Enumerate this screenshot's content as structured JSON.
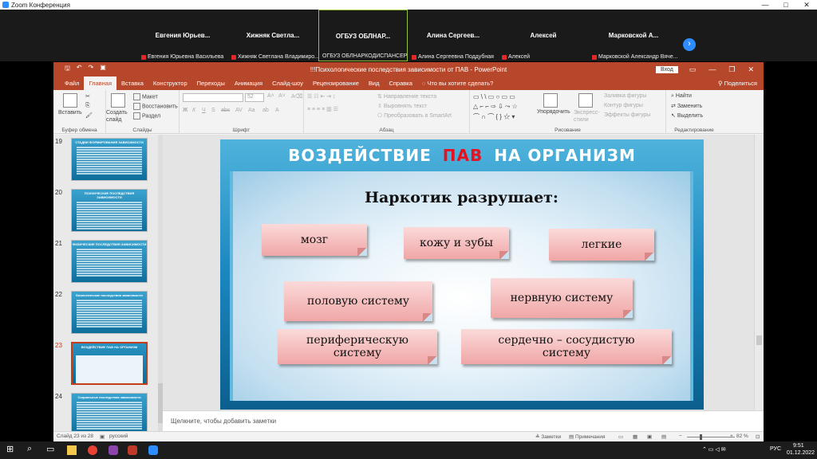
{
  "zoom": {
    "window_title": "Zoom Конференция",
    "window_controls": [
      "—",
      "□",
      "✕"
    ],
    "participants": [
      {
        "name": "Евгения Юрьев...",
        "full_name": "Евгения Юрьевна Васильева"
      },
      {
        "name": "Хижняк Светла...",
        "full_name": "Хижняк Светлана Владимиро..."
      },
      {
        "name": "ОГБУЗ ОБЛНАР...",
        "full_name": "ОГБУЗ ОБЛНАРКОДИСПАНСЕР"
      },
      {
        "name": "Алина Сергеев...",
        "full_name": "Алина Сергеевна Поддубная"
      },
      {
        "name": "Алексей",
        "full_name": "Алексей"
      },
      {
        "name": "Марковской А...",
        "full_name": "Марковской Александр Вяче..."
      }
    ],
    "next_arrow": "›"
  },
  "ppt": {
    "doc_title": "!!!Психологические последствия зависимости от ПАВ - PowerPoint",
    "login_label": "Вход",
    "tabs": [
      "Файл",
      "Главная",
      "Вставка",
      "Конструктор",
      "Переходы",
      "Анимация",
      "Слайд-шоу",
      "Рецензирование",
      "Вид",
      "Справка"
    ],
    "active_tab": "Главная",
    "tell_me": "Что вы хотите сделать?",
    "share_label": "Поделиться",
    "ribbon": {
      "paste": "Вставить",
      "clipboard_group": "Буфер обмена",
      "new_slide": "Создать слайд",
      "layout": "Макет",
      "reset": "Восстановить",
      "section": "Раздел",
      "slides_group": "Слайды",
      "font_size": "52",
      "font_group": "Шрифт",
      "text_direction": "Направление текста",
      "align_text": "Выровнять текст",
      "smartart": "Преобразовать в SmartArt",
      "paragraph_group": "Абзац",
      "arrange": "Упорядочить",
      "quick_styles": "Экспресс-стили",
      "shape_fill": "Заливка фигуры",
      "shape_outline": "Контур фигуры",
      "shape_effects": "Эффекты фигуры",
      "drawing_group": "Рисование",
      "find": "Найти",
      "replace": "Заменить",
      "select": "Выделить",
      "editing_group": "Редактирование"
    },
    "thumbnails": [
      {
        "num": "19",
        "title": "СТАДИИ ФОРМИРОВАНИЯ ЗАВИСИМОСТИ"
      },
      {
        "num": "20",
        "title": "ПСИХИЧЕСКИЕ ПОСЛЕДСТВИЯ ЗАВИСИМОСТИ"
      },
      {
        "num": "21",
        "title": "ФИЗИЧЕСКИЕ ПОСЛЕДСТВИЯ ЗАВИСИМОСТИ"
      },
      {
        "num": "22",
        "title": "Биологические последствия зависимости"
      },
      {
        "num": "23",
        "title": "ВОЗДЕЙСТВИЕ ПАВ НА ОРГАНИЗМ"
      },
      {
        "num": "24",
        "title": "Социальные последствия зависимости"
      }
    ],
    "notes_placeholder": "Щелкните, чтобы добавить заметки",
    "status": {
      "slide_counter": "Слайд 23 из 28",
      "language": "русский",
      "notes": "Заметки",
      "comments": "Примечания",
      "zoom": "82 %"
    }
  },
  "slide": {
    "title_left": "ВОЗДЕЙСТВИЕ",
    "title_highlight": "ПАВ",
    "title_right": "НА ОРГАНИЗМ",
    "subtitle": "Наркотик разрушает:",
    "cards": [
      "мозг",
      "кожу и зубы",
      "легкие",
      "половую систему",
      "нервную систему",
      "периферическую систему",
      "сердечно – сосудистую систему"
    ],
    "colors": {
      "highlight": "#e8121e",
      "card": "#f5b9b9",
      "ppt_accent": "#b7472a"
    }
  },
  "taskbar": {
    "lang": "РУС",
    "time": "9:51",
    "date": "01.12.2022"
  }
}
